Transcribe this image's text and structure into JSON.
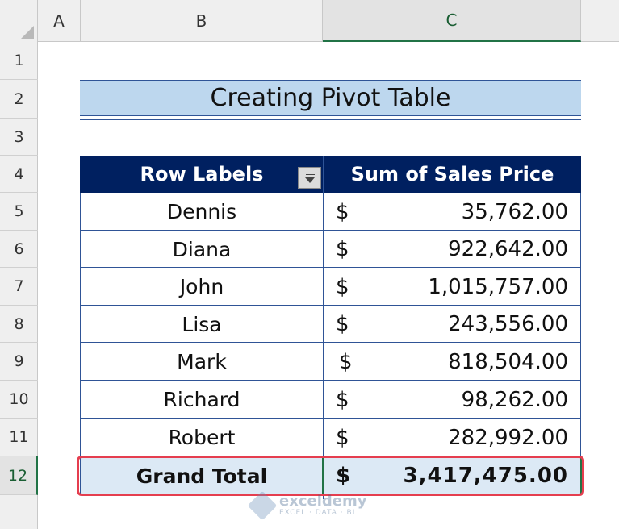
{
  "columns": [
    {
      "label": "A"
    },
    {
      "label": "B"
    },
    {
      "label": "C",
      "selected": true
    }
  ],
  "rows": [
    "1",
    "2",
    "3",
    "4",
    "5",
    "6",
    "7",
    "8",
    "9",
    "10",
    "11",
    "12"
  ],
  "title": "Creating Pivot Table",
  "pivot": {
    "header_row_labels": "Row Labels",
    "header_sum": "Sum of Sales Price",
    "currency": "$",
    "items": [
      {
        "name": "Dennis",
        "amount": "35,762.00"
      },
      {
        "name": "Diana",
        "amount": "922,642.00"
      },
      {
        "name": "John",
        "amount": "1,015,757.00"
      },
      {
        "name": "Lisa",
        "amount": "243,556.00"
      },
      {
        "name": "Mark",
        "amount": "818,504.00"
      },
      {
        "name": "Richard",
        "amount": "98,262.00"
      },
      {
        "name": "Robert",
        "amount": "282,992.00"
      }
    ],
    "total_label": "Grand Total",
    "total_amount": "3,417,475.00"
  },
  "watermark": {
    "brand": "exceldemy",
    "tagline": "EXCEL · DATA · BI"
  },
  "colors": {
    "header_bg": "#002060",
    "title_bg": "#bdd7ee",
    "total_bg": "#dce9f5",
    "highlight": "#e53e4f",
    "excel_green": "#217346"
  }
}
